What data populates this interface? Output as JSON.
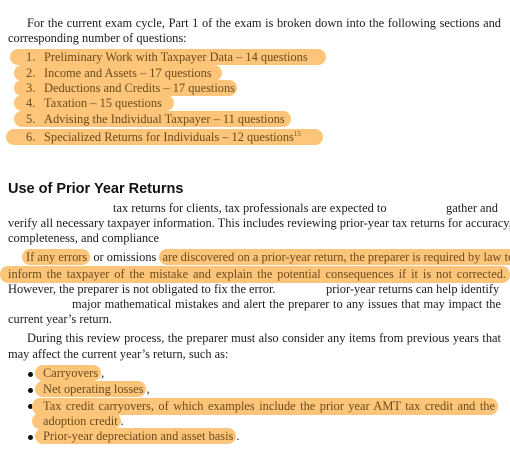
{
  "intro": {
    "line1": "For the current exam cycle, Part 1 of the exam is broken down into the following sections and",
    "line2": "corresponding number of questions:"
  },
  "sections": [
    {
      "num": "1.",
      "text": "Preliminary Work with Taxpayer Data – 14 questions"
    },
    {
      "num": "2.",
      "text": "Income and Assets – 17 questions"
    },
    {
      "num": "3.",
      "text": "Deductions and Credits – 17 questions"
    },
    {
      "num": "4.",
      "text": "Taxation – 15 questions"
    },
    {
      "num": "5.",
      "text": "Advising the Individual Taxpayer – 11 questions"
    },
    {
      "num": "6.",
      "text": "Specialized Returns for Individuals – 12 questions",
      "footnote": "15"
    }
  ],
  "heading": "Use of Prior Year Returns",
  "para1": {
    "l1a": "tax returns for clients, tax professionals are expected to",
    "l1b": "gather and",
    "l2": "verify all necessary taxpayer information. This includes reviewing prior-year tax returns for accuracy,",
    "l3": "completeness, and compliance"
  },
  "para2": {
    "l1_h1": "If any errors",
    "l1_p1": "or omissions",
    "l1_h2": "are discovered on a prior-year return, the preparer is required by law to",
    "l2": "inform the taxpayer of the mistake and explain the potential consequences if it is not corrected.",
    "l3a": "However, the preparer is not obligated to fix the error.",
    "l3b": "prior-year returns can help identify",
    "l4": "major mathematical mistakes and alert the preparer to any issues that may impact the",
    "l5": "current year’s return."
  },
  "para3": {
    "l1": "During this review process, the preparer must also consider any items from previous years that",
    "l2": "may affect the current year’s return, such as:"
  },
  "bullets": [
    {
      "text": "Carryovers",
      "tail": ","
    },
    {
      "text": "Net operating losses",
      "tail": ","
    },
    {
      "text": "Tax credit carryovers, of which examples include the prior year AMT tax credit and the",
      "cont": "adoption credit",
      "tail": "."
    },
    {
      "text": "Prior-year depreciation and asset basis",
      "tail": "."
    }
  ],
  "colors": {
    "highlight": "#fdc57a"
  }
}
